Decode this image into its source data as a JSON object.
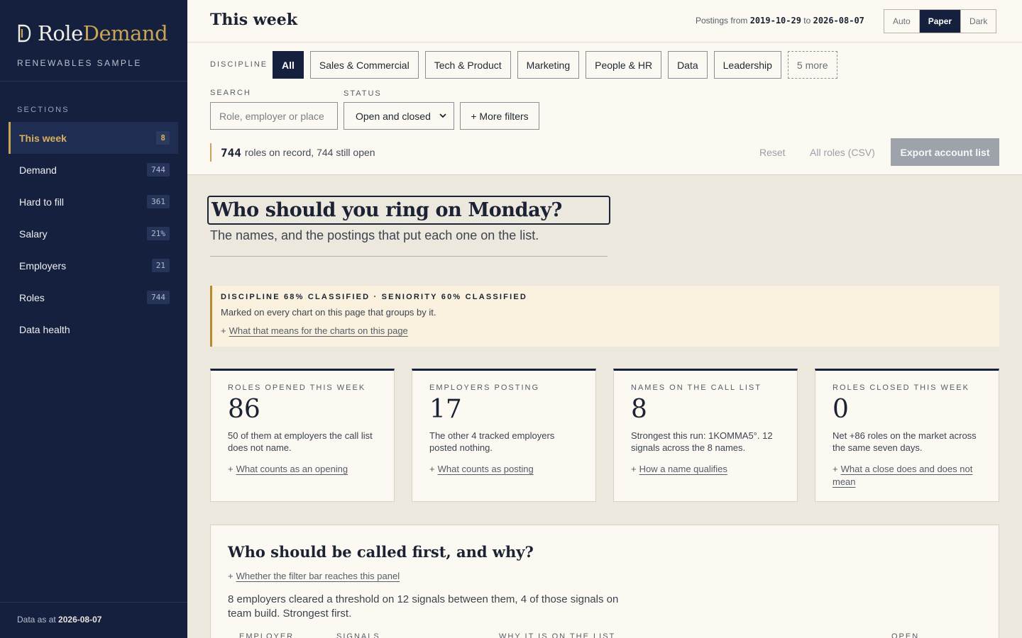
{
  "brand": {
    "name_a": "Role",
    "name_b": "Demand",
    "subtitle": "RENEWABLES SAMPLE",
    "accent_color": "#c9a455"
  },
  "sidebar": {
    "sections_label": "SECTIONS",
    "items": [
      {
        "label": "This week",
        "count": "8",
        "active": true
      },
      {
        "label": "Demand",
        "count": "744"
      },
      {
        "label": "Hard to fill",
        "count": "361"
      },
      {
        "label": "Salary",
        "count": "21%"
      },
      {
        "label": "Employers",
        "count": "21"
      },
      {
        "label": "Roles",
        "count": "744"
      },
      {
        "label": "Data health",
        "count": ""
      }
    ],
    "footer_prefix": "Data as at",
    "footer_date": "2026-08-07"
  },
  "header": {
    "title": "This week",
    "postings_prefix": "Postings from",
    "postings_from": "2019-10-29",
    "postings_to_word": "to",
    "postings_to": "2026-08-07",
    "themes": [
      "Auto",
      "Paper",
      "Dark"
    ],
    "active_theme": "Paper"
  },
  "filters": {
    "discipline_label": "DISCIPLINE",
    "disciplines": [
      "All",
      "Sales & Commercial",
      "Tech & Product",
      "Marketing",
      "People & HR",
      "Data",
      "Leadership"
    ],
    "more_chip": "5 more",
    "search_label": "SEARCH",
    "search_placeholder": "Role, employer or place",
    "status_label": "STATUS",
    "status_value": "Open and closed",
    "more_filters": "+ More filters"
  },
  "summary": {
    "count": "744",
    "text": "roles on record, 744 still open",
    "reset": "Reset",
    "csv": "All roles (CSV)",
    "export": "Export account list"
  },
  "hero": {
    "title": "Who should you ring on Monday?",
    "subtitle": "The names, and the postings that put each one on the list."
  },
  "callout": {
    "title": "DISCIPLINE 68% CLASSIFIED · SENIORITY 60% CLASSIFIED",
    "text": "Marked on every chart on this page that groups by it.",
    "link": "What that means for the charts on this page"
  },
  "kpis": [
    {
      "label": "ROLES OPENED THIS WEEK",
      "value": "86",
      "text": "50 of them at employers the call list does not name.",
      "link": "What counts as an opening"
    },
    {
      "label": "EMPLOYERS POSTING",
      "value": "17",
      "text": "The other 4 tracked employers posted nothing.",
      "link": "What counts as posting"
    },
    {
      "label": "NAMES ON THE CALL LIST",
      "value": "8",
      "text": "Strongest this run: 1KOMMA5°. 12 signals across the 8 names.",
      "link": "How a name qualifies"
    },
    {
      "label": "ROLES CLOSED THIS WEEK",
      "value": "0",
      "text": "Net +86 roles on the market across the same seven days.",
      "link": "What a close does and does not mean"
    }
  ],
  "panel": {
    "title": "Who should be called first, and why?",
    "link": "Whether the filter bar reaches this panel",
    "text": "8 employers cleared a threshold on 12 signals between them, 4 of those signals on team build. Strongest first.",
    "columns": [
      "EMPLOYER",
      "SIGNALS",
      "WHY IT IS ON THE LIST",
      "OPEN"
    ]
  }
}
